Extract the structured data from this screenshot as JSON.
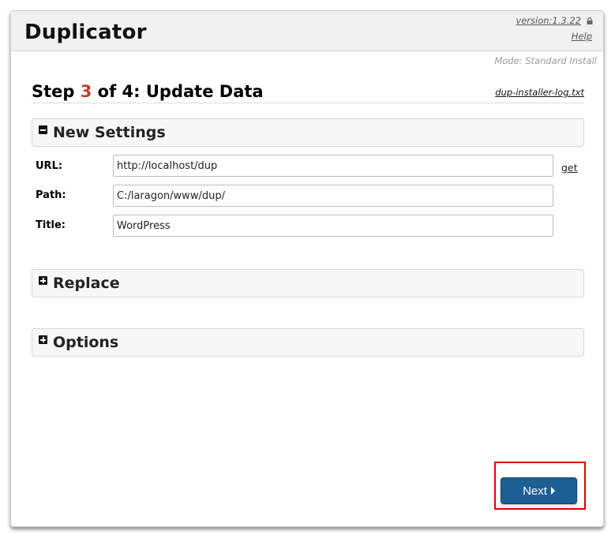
{
  "header": {
    "brand": "Duplicator",
    "version": "version:1.3.22",
    "help": "Help"
  },
  "mode": "Mode: Standard Install",
  "step": {
    "prefix": "Step ",
    "number": "3",
    "suffix": " of 4: Update Data"
  },
  "log_link": "dup-installer-log.txt",
  "sections": {
    "new_settings": {
      "label": "New Settings",
      "expanded": true
    },
    "replace": {
      "label": "Replace",
      "expanded": false
    },
    "options": {
      "label": "Options",
      "expanded": false
    }
  },
  "fields": {
    "url": {
      "label": "URL:",
      "value": "http://localhost/dup"
    },
    "path": {
      "label": "Path:",
      "value": "C:/laragon/www/dup/"
    },
    "title": {
      "label": "Title:",
      "value": "WordPress"
    }
  },
  "get_link": "get",
  "next_button": "Next",
  "colors": {
    "accent_step": "#b5462b",
    "button": "#1d5e93",
    "highlight": "#e00000"
  }
}
